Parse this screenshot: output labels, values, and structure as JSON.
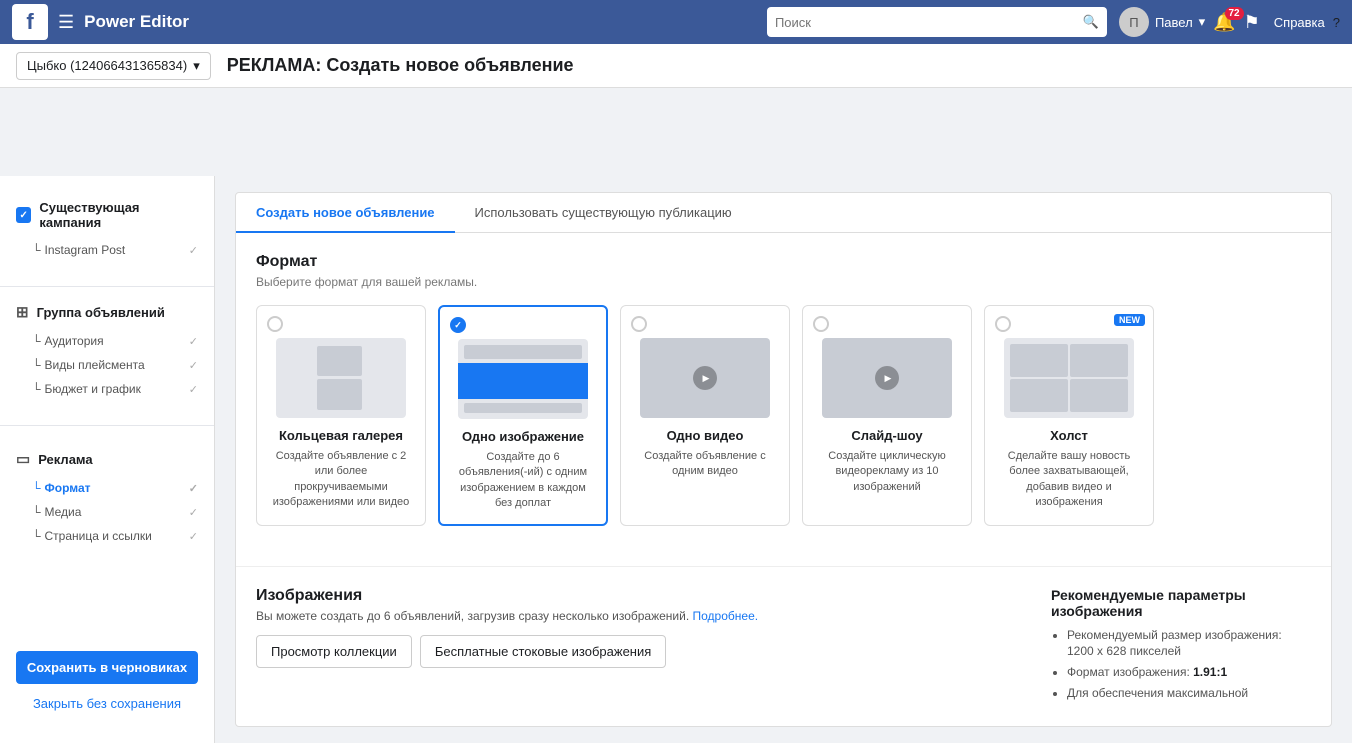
{
  "topnav": {
    "logo": "f",
    "menu_icon": "☰",
    "title": "Power Editor",
    "search_placeholder": "Поиск",
    "user_name": "Павел",
    "badge_count": "72",
    "help_label": "Справка"
  },
  "subheader": {
    "account": "Цыбко (124066431365834)",
    "heading": "РЕКЛАМА: Создать новое объявление"
  },
  "sidebar": {
    "campaign_label": "Существующая кампания",
    "instagram_post": "Instagram Post",
    "ad_groups_label": "Группа объявлений",
    "audience_label": "Аудитория",
    "placement_label": "Виды плейсмента",
    "budget_label": "Бюджет и график",
    "ads_label": "Реклама",
    "format_label": "Формат",
    "media_label": "Медиа",
    "page_links_label": "Страница и ссылки",
    "save_button": "Сохранить в черновиках",
    "close_button": "Закрыть без сохранения"
  },
  "tabs": {
    "tab1": "Создать новое объявление",
    "tab2": "Использовать существующую публикацию"
  },
  "format_section": {
    "title": "Формат",
    "desc": "Выберите формат для вашей рекламы.",
    "formats": [
      {
        "id": "carousel",
        "name": "Кольцевая галерея",
        "desc": "Создайте объявление с 2 или более прокручиваемыми изображениями или видео",
        "selected": false,
        "new": false
      },
      {
        "id": "single_image",
        "name": "Одно изображение",
        "desc": "Создайте до 6 объявления(-ий) с одним изображением в каждом без доплат",
        "selected": true,
        "new": false
      },
      {
        "id": "single_video",
        "name": "Одно видео",
        "desc": "Создайте объявление с одним видео",
        "selected": false,
        "new": false
      },
      {
        "id": "slideshow",
        "name": "Слайд-шоу",
        "desc": "Создайте циклическую видеорекламу из 10 изображений",
        "selected": false,
        "new": false
      },
      {
        "id": "canvas",
        "name": "Холст",
        "desc": "Сделайте вашу новость более захватывающей, добавив видео и изображения",
        "selected": false,
        "new": true
      }
    ]
  },
  "images_section": {
    "title": "Изображения",
    "desc_main": "Вы можете создать до 6 объявлений, загрузив сразу несколько изображений.",
    "desc_link": "Подробнее.",
    "btn1": "Просмотр коллекции",
    "btn2": "Бесплатные стоковые изображения",
    "rec_title": "Рекомендуемые параметры изображения",
    "rec_items": [
      "Рекомендуемый размер изображения: 1200 х 628 пикселей",
      "Формат изображения: 1.91:1",
      "Для обеспечения максимальной"
    ]
  }
}
